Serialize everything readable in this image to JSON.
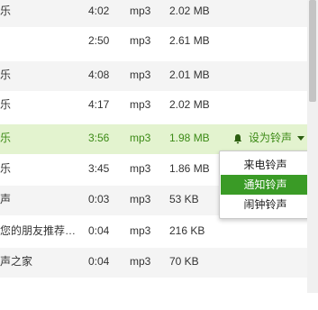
{
  "rows": [
    {
      "name": "乐",
      "duration": "4:02",
      "format": "mp3",
      "size": "2.02 MB"
    },
    {
      "name": "",
      "duration": "2:50",
      "format": "mp3",
      "size": "2.61 MB"
    },
    {
      "name": "乐",
      "duration": "4:08",
      "format": "mp3",
      "size": "2.01 MB"
    },
    {
      "name": "乐",
      "duration": "4:17",
      "format": "mp3",
      "size": "2.02 MB"
    },
    {
      "name": "乐",
      "duration": "3:56",
      "format": "mp3",
      "size": "1.98 MB"
    },
    {
      "name": "乐",
      "duration": "3:45",
      "format": "mp3",
      "size": "1.86 MB"
    },
    {
      "name": "声",
      "duration": "0:03",
      "format": "mp3",
      "size": "53 KB"
    },
    {
      "name": "您的朋友推荐…",
      "duration": "0:04",
      "format": "mp3",
      "size": "216 KB"
    },
    {
      "name": "声之家",
      "duration": "0:04",
      "format": "mp3",
      "size": "70 KB"
    }
  ],
  "selected_index": 4,
  "set_ringtone_label": "设为铃声",
  "ringtone_menu": {
    "items": [
      "来电铃声",
      "通知铃声",
      "闹钟铃声"
    ],
    "active_index": 1
  },
  "colors": {
    "selected_row_bg": "#e3f3cf",
    "accent_green": "#3a9b26"
  }
}
